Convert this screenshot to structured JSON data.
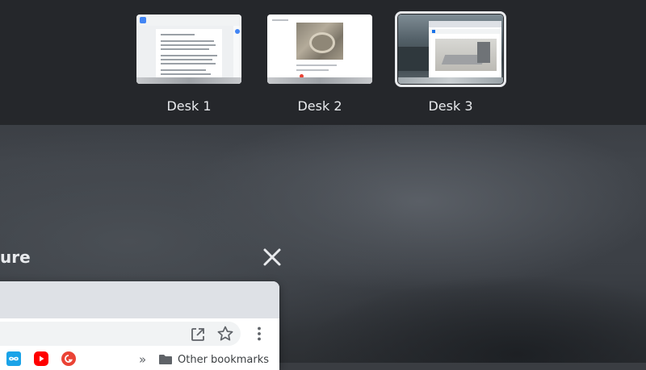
{
  "desks": [
    {
      "label": "Desk 1",
      "active": false
    },
    {
      "label": "Desk 2",
      "active": false
    },
    {
      "label": "Desk 3",
      "active": true
    }
  ],
  "window": {
    "title_fragment": "ure"
  },
  "browser": {
    "bookmarks_overflow": "»",
    "other_bookmarks_label": "Other bookmarks"
  },
  "icons": {
    "close": "close-icon",
    "open_in_new": "open-in-new-icon",
    "star": "star-icon",
    "more": "more-vert-icon"
  },
  "colors": {
    "desk_bar_bg": "#25272b",
    "active_outline": "#e8eaed",
    "text": "#e8eaed"
  }
}
